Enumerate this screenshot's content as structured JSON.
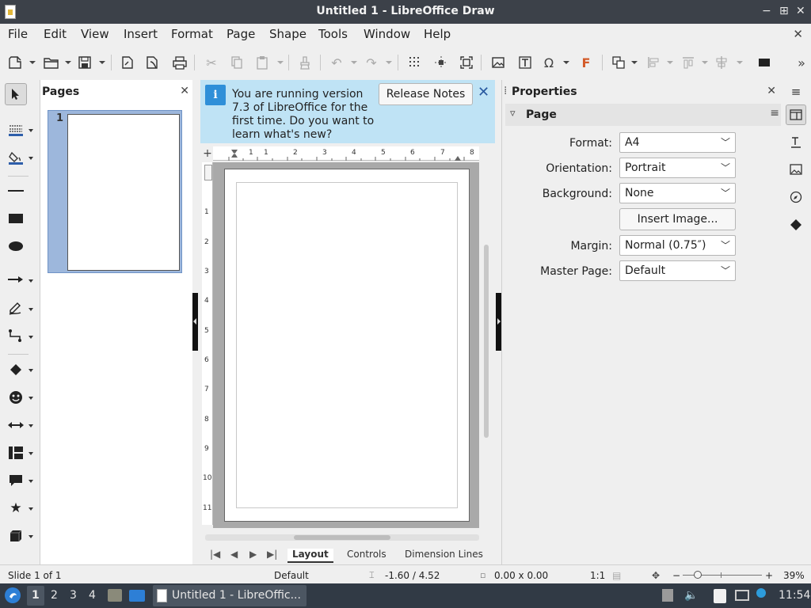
{
  "window": {
    "title": "Untitled 1 - LibreOffice Draw",
    "controls": [
      "−",
      "⊞",
      "✕"
    ]
  },
  "menu": {
    "items": [
      "File",
      "Edit",
      "View",
      "Insert",
      "Format",
      "Page",
      "Shape",
      "Tools",
      "Window",
      "Help"
    ],
    "close": "✕"
  },
  "pages_pane": {
    "title": "Pages",
    "close": "✕",
    "pages": [
      {
        "number": "1"
      }
    ]
  },
  "infobar": {
    "message": "You are running version 7.3 of LibreOffice for the first time. Do you want to learn what's new?",
    "button": "Release Notes",
    "close": "✕",
    "icon": "i"
  },
  "rulers": {
    "horizontal": [
      "1",
      "1",
      "2",
      "3",
      "4",
      "5",
      "6",
      "7",
      "8"
    ],
    "vertical": [
      "1",
      "2",
      "3",
      "4",
      "5",
      "6",
      "7",
      "8",
      "9",
      "10",
      "11"
    ]
  },
  "bottom_tabs": {
    "tabs": [
      "Layout",
      "Controls",
      "Dimension Lines"
    ],
    "active": "Layout"
  },
  "properties": {
    "title": "Properties",
    "close": "✕",
    "section": "Page",
    "fields": {
      "format_label": "Format:",
      "format_value": "A4",
      "orientation_label": "Orientation:",
      "orientation_value": "Portrait",
      "background_label": "Background:",
      "background_value": "None",
      "insert_image": "Insert Image...",
      "margin_label": "Margin:",
      "margin_value": "Normal (0.75″)",
      "master_label": "Master Page:",
      "master_value": "Default"
    }
  },
  "statusbar": {
    "slide": "Slide 1 of 1",
    "layout": "Default",
    "position": "-1.60 / 4.52",
    "size": "0.00 x 0.00",
    "scale": "1:1",
    "zoom": "39%",
    "zoom_minus": "−",
    "zoom_plus": "+"
  },
  "taskbar": {
    "workspaces": [
      "1",
      "2",
      "3",
      "4"
    ],
    "window_label": "Untitled 1 - LibreOffic...",
    "clock": "11:54"
  },
  "colors": {
    "titlebar": "#3c4149",
    "infobar": "#bfe3f5",
    "page_selection": "#9db7dc",
    "taskbar": "#313a45"
  }
}
